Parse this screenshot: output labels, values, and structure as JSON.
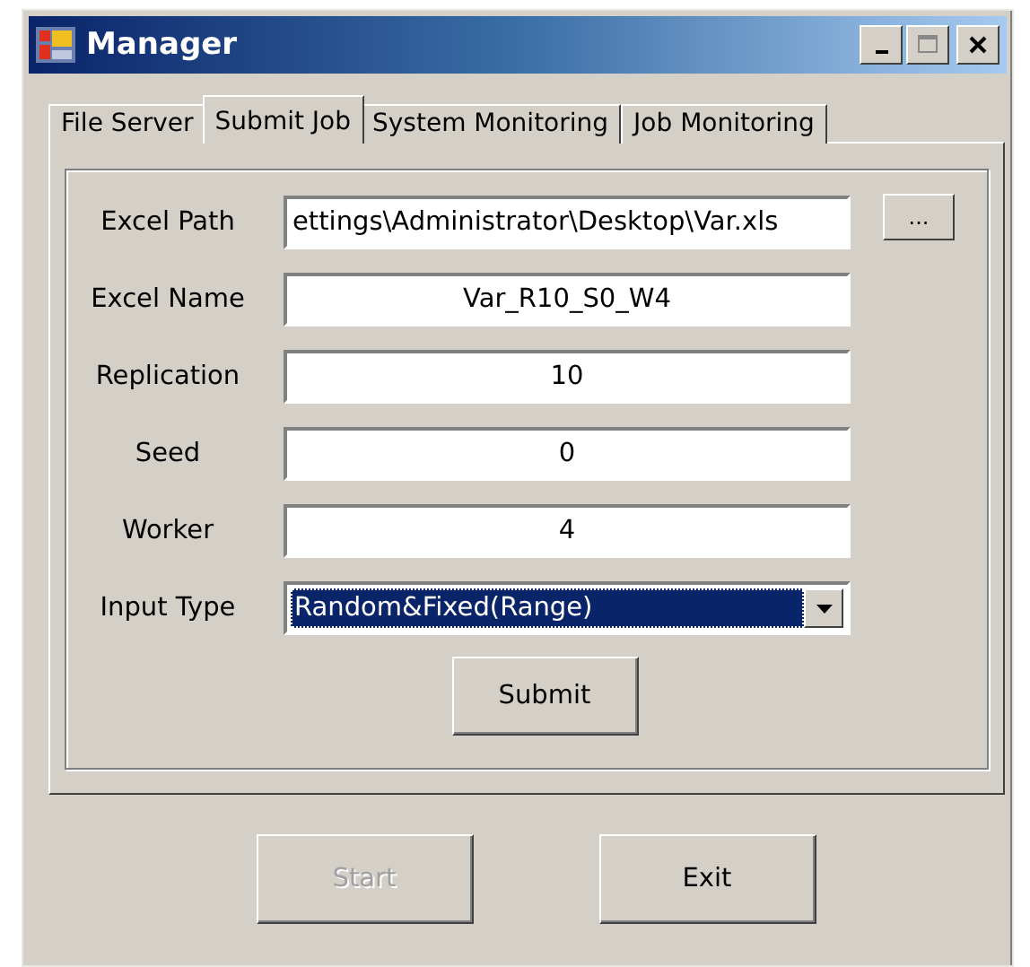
{
  "window": {
    "title": "Manager"
  },
  "tabs": [
    {
      "label": "File Server",
      "selected": false
    },
    {
      "label": "Submit Job",
      "selected": true
    },
    {
      "label": "System Monitoring",
      "selected": false
    },
    {
      "label": "Job Monitoring",
      "selected": false
    }
  ],
  "form": {
    "fields": [
      {
        "kind": "path",
        "label": "Excel Path",
        "value": "ettings\\Administrator\\Desktop\\Var.xls",
        "browse": "..."
      },
      {
        "kind": "text",
        "label": "Excel Name",
        "value": "Var_R10_S0_W4"
      },
      {
        "kind": "text",
        "label": "Replication",
        "value": "10"
      },
      {
        "kind": "text",
        "label": "Seed",
        "value": "0"
      },
      {
        "kind": "text",
        "label": "Worker",
        "value": "4"
      },
      {
        "kind": "dropdown",
        "label": "Input Type",
        "value": "Random&Fixed(Range)"
      }
    ],
    "submit": "Submit"
  },
  "buttons": [
    {
      "label": "Start",
      "disabled": true
    },
    {
      "label": "Exit",
      "disabled": false
    }
  ]
}
